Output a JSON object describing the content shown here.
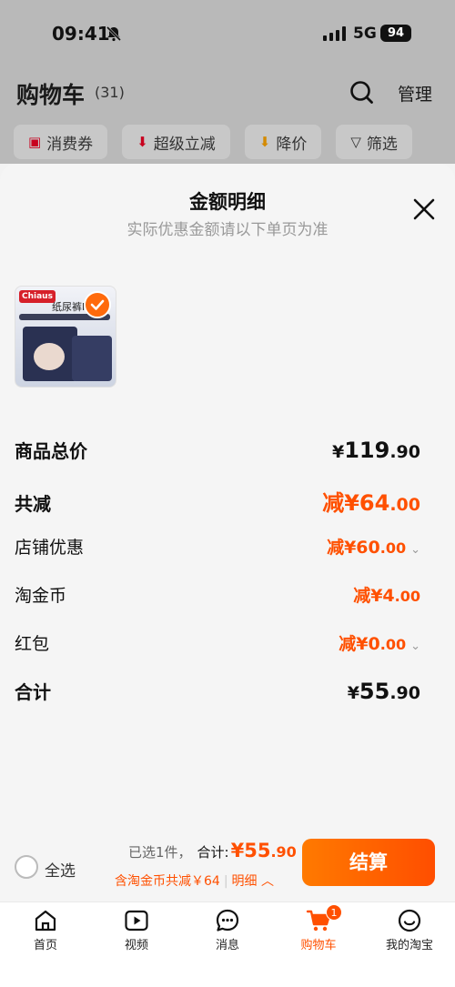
{
  "status_bar": {
    "time": "09:41",
    "network": "5G",
    "battery": "94"
  },
  "cart_header": {
    "title": "购物车",
    "count": "(31)",
    "manage_label": "管理",
    "chips": [
      {
        "icon": "coupon-icon",
        "label": "消费券"
      },
      {
        "icon": "arrow-down-icon",
        "label": "超级立减"
      },
      {
        "icon": "price-down-icon",
        "label": "降价"
      },
      {
        "icon": "filter-icon",
        "label": "筛选"
      }
    ]
  },
  "sheet": {
    "title": "金额明细",
    "subtitle": "实际优惠金额请以下单页为准",
    "product": {
      "brand": "Chiaus",
      "name": "纸尿裤NB"
    },
    "rows": {
      "total_label": "商品总价",
      "total_yen": "¥",
      "total_int": "119",
      "total_dec": ".90",
      "reduce_label": "共减",
      "reduce_value": "减¥64",
      "reduce_dec": ".00",
      "store_label": "店铺优惠",
      "store_value": "减¥60",
      "store_dec": ".00",
      "coin_label": "淘金币",
      "coin_value": "减¥4",
      "coin_dec": ".00",
      "redpack_label": "红包",
      "redpack_value": "减¥0",
      "redpack_dec": ".00",
      "sum_label": "合计",
      "sum_yen": "¥",
      "sum_int": "55",
      "sum_dec": ".90"
    }
  },
  "checkout": {
    "select_all_label": "全选",
    "selected_text": "已选1件，",
    "total_label": "合计:",
    "total_value": "¥55",
    "total_dec": ".90",
    "discount_text": "含淘金币共减￥64",
    "detail_label": "明细",
    "pay_label": "结算"
  },
  "tabbar": {
    "items": [
      {
        "label": "首页",
        "icon": "home-icon"
      },
      {
        "label": "视频",
        "icon": "video-icon"
      },
      {
        "label": "消息",
        "icon": "message-icon"
      },
      {
        "label": "购物车",
        "icon": "cart-icon",
        "badge": "1",
        "active": true
      },
      {
        "label": "我的淘宝",
        "icon": "profile-icon"
      }
    ]
  },
  "colors": {
    "accent": "#ff5000",
    "overlay": "#b9b9b9"
  }
}
